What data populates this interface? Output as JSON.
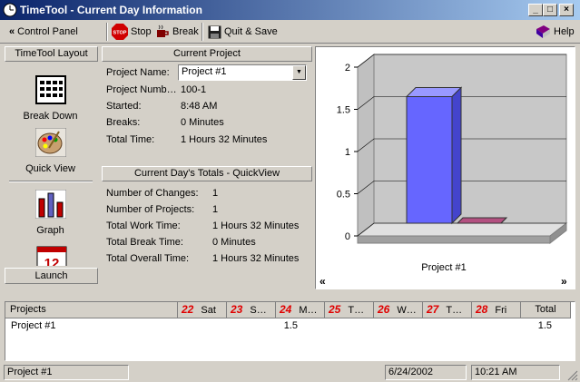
{
  "window": {
    "title": "TimeTool - Current Day Information",
    "buttons": {
      "minimize": "_",
      "maximize": "□",
      "close": "×"
    }
  },
  "toolbar": {
    "control_panel": "Control Panel",
    "stop": "Stop",
    "stop_badge": "STOP",
    "break": "Break",
    "quit_save": "Quit & Save",
    "help": "Help"
  },
  "sidebar": {
    "header": "TimeTool Layout",
    "items": [
      {
        "label": "Break Down",
        "icon": "calendar-grid-icon"
      },
      {
        "label": "Quick View",
        "icon": "palette-icon"
      },
      {
        "label": "Graph",
        "icon": "bar-graph-icon"
      },
      {
        "label": "",
        "icon": "calendar-page-icon"
      }
    ],
    "calendar_icon_number": "12",
    "footer": "Launch"
  },
  "current_project": {
    "header": "Current Project",
    "fields": [
      {
        "label": "Project Name:",
        "value": "Project #1"
      },
      {
        "label": "Project Numb…",
        "value": "100-1"
      },
      {
        "label": "Started:",
        "value": "8:48 AM"
      },
      {
        "label": "Breaks:",
        "value": "0 Minutes"
      },
      {
        "label": "Total Time:",
        "value": "1 Hours 32 Minutes"
      }
    ]
  },
  "totals": {
    "header": "Current Day's Totals - QuickView",
    "rows": [
      {
        "label": "Number of Changes:",
        "value": "1"
      },
      {
        "label": "Number of Projects:",
        "value": "1"
      },
      {
        "label": "Total Work Time:",
        "value": "1 Hours 32 Minutes"
      },
      {
        "label": "Total Break Time:",
        "value": "0 Minutes"
      },
      {
        "label": "Total Overall Time:",
        "value": "1 Hours 32 Minutes"
      }
    ]
  },
  "chart_data": {
    "type": "bar",
    "categories": [
      "Project #1"
    ],
    "series": [
      {
        "values": [
          1.5
        ],
        "color": "#6666ff"
      },
      {
        "values": [
          0
        ],
        "color": "#993366"
      }
    ],
    "ylim": [
      0,
      2
    ],
    "yticks": [
      "2",
      "1.5",
      "1",
      "0.5",
      "0"
    ],
    "grid": true,
    "nav_left": "«",
    "nav_right": "»"
  },
  "grid": {
    "headers": [
      {
        "day": "",
        "name": "Projects"
      },
      {
        "day": "22",
        "name": "Sat"
      },
      {
        "day": "23",
        "name": "S…"
      },
      {
        "day": "24",
        "name": "M…"
      },
      {
        "day": "25",
        "name": "T…"
      },
      {
        "day": "26",
        "name": "W…"
      },
      {
        "day": "27",
        "name": "T…"
      },
      {
        "day": "28",
        "name": "Fri"
      },
      {
        "day": "",
        "name": "Total"
      }
    ],
    "rows": [
      {
        "project": "Project #1",
        "mon": "1.5",
        "total": "1.5"
      }
    ]
  },
  "status": {
    "project": "Project #1",
    "date": "6/24/2002",
    "time": "10:21 AM"
  },
  "colors": {
    "titlebar_start": "#0a246a",
    "titlebar_end": "#a6caf0",
    "day_number": "#e00000",
    "bar_primary": "#6666ff"
  }
}
